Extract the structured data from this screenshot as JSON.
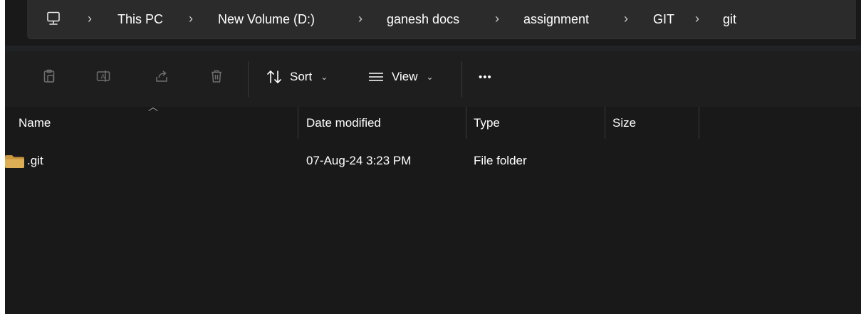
{
  "breadcrumb": {
    "root_icon": "computer-monitor-icon",
    "separator": "›",
    "items": [
      "This PC",
      "New Volume (D:)",
      "ganesh docs",
      "assignment",
      "GIT",
      "git"
    ]
  },
  "toolbar": {
    "icons": [
      "paste-icon",
      "rename-icon",
      "share-icon",
      "delete-icon"
    ],
    "sort_label": "Sort",
    "view_label": "View",
    "more_label": "•••"
  },
  "columns": [
    "Name",
    "Date modified",
    "Type",
    "Size"
  ],
  "files": [
    {
      "name": ".git",
      "date_modified": "07-Aug-24 3:23 PM",
      "type": "File folder",
      "size": "",
      "icon": "folder-icon"
    }
  ],
  "colors": {
    "background": "#191919",
    "address_bar": "#2b2b2b",
    "folder": "#d6a64b"
  }
}
